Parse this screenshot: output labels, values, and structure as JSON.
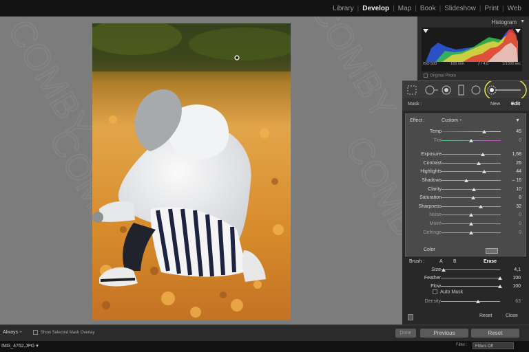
{
  "topbar": {
    "modules": [
      {
        "label": "Library",
        "active": false
      },
      {
        "label": "Develop",
        "active": true
      },
      {
        "label": "Map",
        "active": false
      },
      {
        "label": "Book",
        "active": false
      },
      {
        "label": "Slideshow",
        "active": false
      },
      {
        "label": "Print",
        "active": false
      },
      {
        "label": "Web",
        "active": false
      }
    ]
  },
  "histogram": {
    "title": "Histogram",
    "iso": "ISO 500",
    "focal": "165 mm",
    "aperture": "ƒ / 4,0",
    "shutter": "1/1000 sec",
    "original_photo": "Original Photo"
  },
  "mask": {
    "label": "Mask :",
    "new": "New",
    "edit": "Edit"
  },
  "effect": {
    "label": "Effect :",
    "preset": "Custom ÷",
    "adjustments": [
      {
        "label": "Temp",
        "value": "45",
        "pos": 0.72,
        "track": "temp",
        "dim": false
      },
      {
        "label": "Tint",
        "value": "0",
        "pos": 0.5,
        "track": "tint",
        "dim": true
      },
      {
        "label": "Exposure",
        "value": "1,68",
        "pos": 0.7,
        "track": "",
        "dim": false
      },
      {
        "label": "Contrast",
        "value": "26",
        "pos": 0.63,
        "track": "",
        "dim": false
      },
      {
        "label": "Highlights",
        "value": "44",
        "pos": 0.72,
        "track": "",
        "dim": false
      },
      {
        "label": "Shadows",
        "value": "– 16",
        "pos": 0.42,
        "track": "",
        "dim": false
      },
      {
        "label": "Clarity",
        "value": "10",
        "pos": 0.55,
        "track": "",
        "dim": false
      },
      {
        "label": "Saturation",
        "value": "8",
        "pos": 0.54,
        "track": "",
        "dim": false
      },
      {
        "label": "Sharpness",
        "value": "32",
        "pos": 0.66,
        "track": "",
        "dim": false
      },
      {
        "label": "Noise",
        "value": "0",
        "pos": 0.5,
        "track": "",
        "dim": true
      },
      {
        "label": "Moiré",
        "value": "0",
        "pos": 0.5,
        "track": "",
        "dim": true
      },
      {
        "label": "Defringe",
        "value": "0",
        "pos": 0.5,
        "track": "",
        "dim": true
      }
    ],
    "color_label": "Color"
  },
  "brush": {
    "label": "Brush :",
    "a": "A",
    "b": "B",
    "erase": "Erase",
    "settings": [
      {
        "label": "Size",
        "value": "4,1",
        "pos": 0.05,
        "dim": false
      },
      {
        "label": "Feather",
        "value": "100",
        "pos": 1.0,
        "dim": false
      },
      {
        "label": "Flow",
        "value": "100",
        "pos": 1.0,
        "dim": false
      },
      {
        "label": "Density",
        "value": "63",
        "pos": 0.63,
        "dim": true
      }
    ],
    "auto_mask": "Auto Mask"
  },
  "panel_footer": {
    "reset": "Reset",
    "close": "Close"
  },
  "toolbar": {
    "overlay_mode": "Always ÷",
    "show_overlay": "Show Selected Mask Overlay",
    "done": "Done",
    "previous": "Previous",
    "reset": "Reset"
  },
  "filmstrip": {
    "filename": "IMG_4762.JPG ▾",
    "filter_label": "Filter :",
    "filter_value": "Filters Off"
  },
  "watermark": "COMBY"
}
